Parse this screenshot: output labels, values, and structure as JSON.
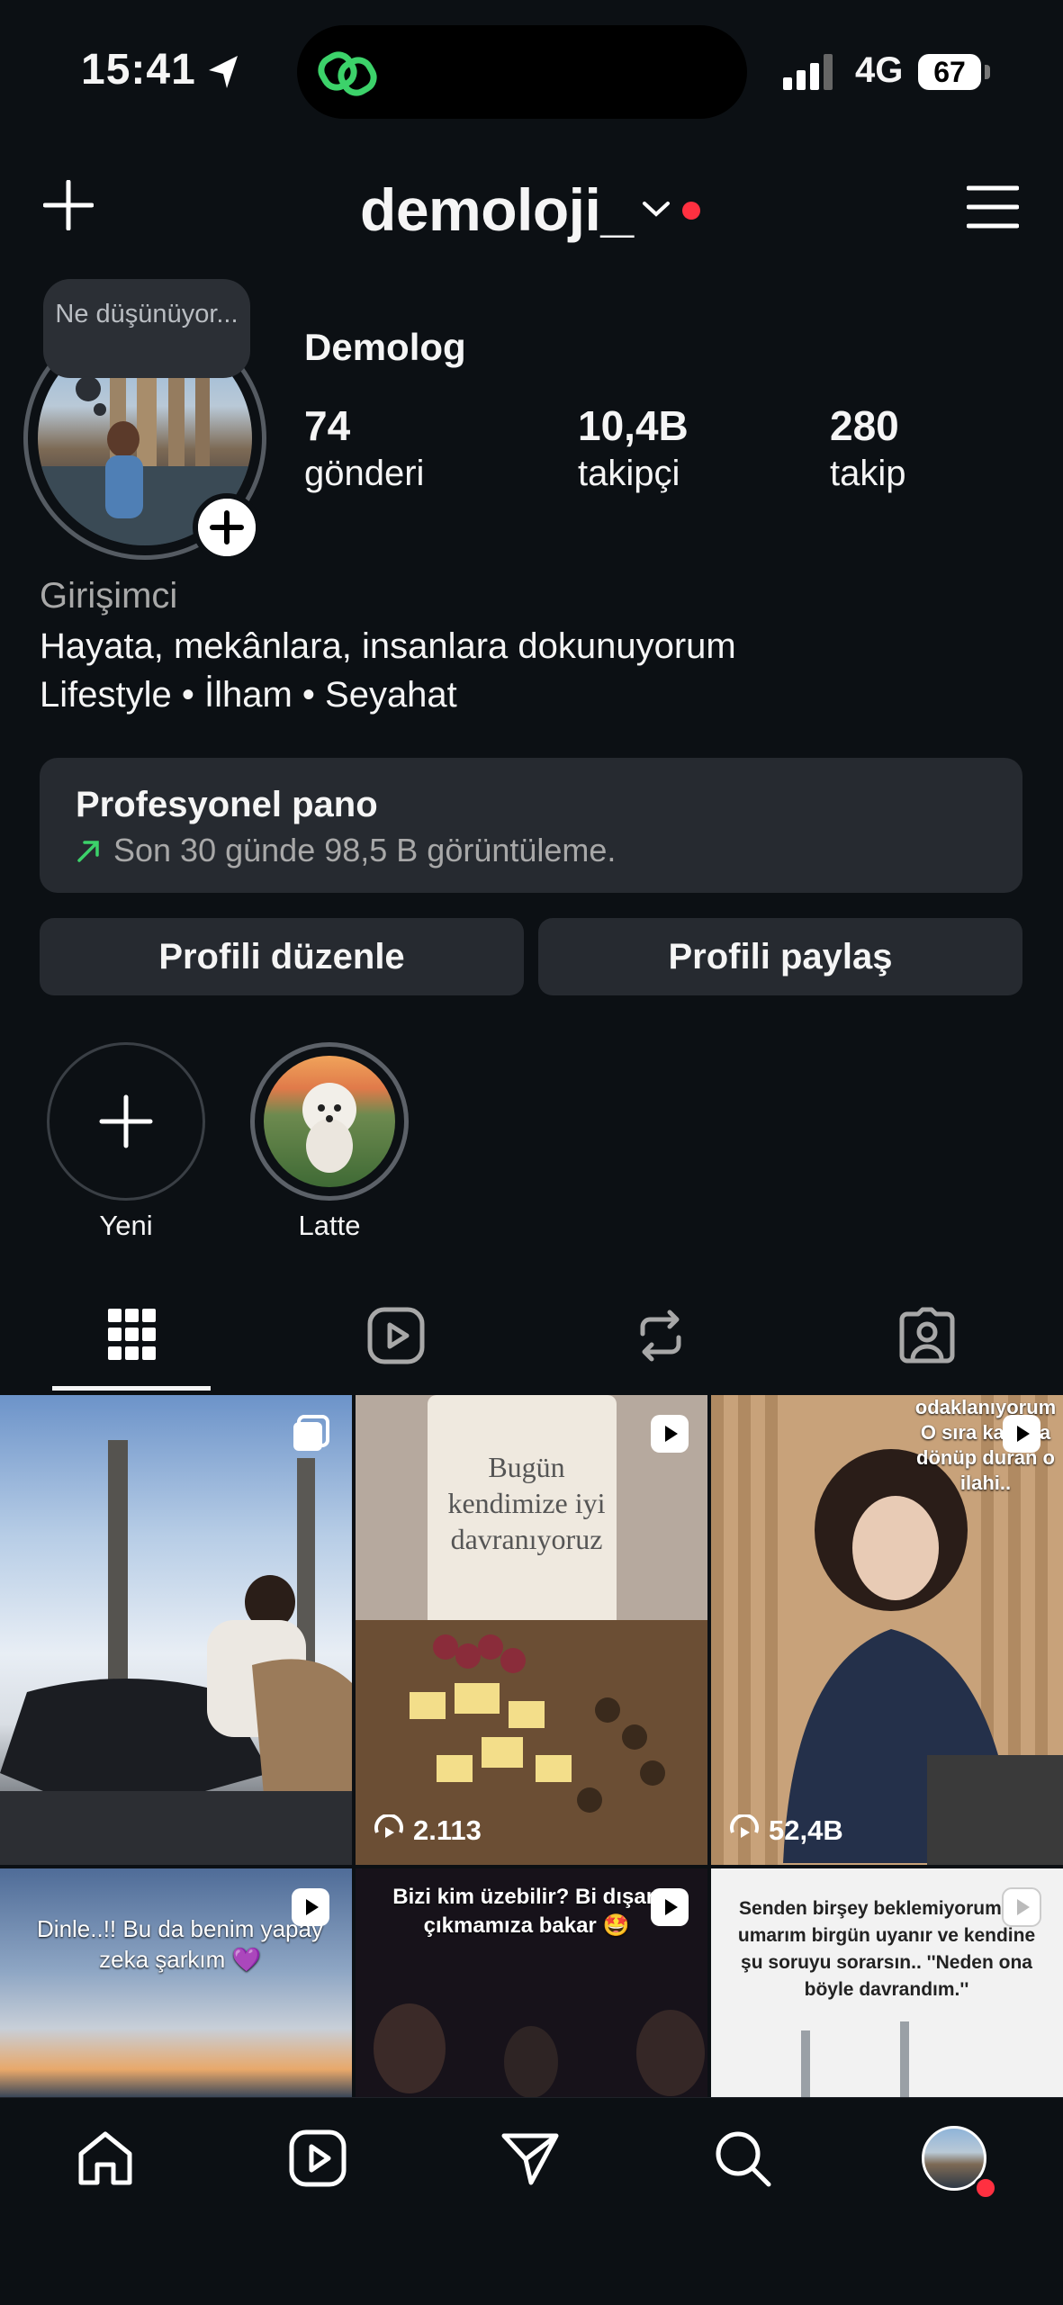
{
  "status_bar": {
    "time": "15:41",
    "network": "4G",
    "battery": "67"
  },
  "header": {
    "username": "demoloji_"
  },
  "profile": {
    "note_bubble": "Ne düşünüyor...",
    "display_name": "Demolog",
    "stats": [
      {
        "value": "74",
        "label": "gönderi"
      },
      {
        "value": "10,4B",
        "label": "takipçi"
      },
      {
        "value": "280",
        "label": "takip"
      }
    ],
    "bio": {
      "category": "Girişimci",
      "line1": "Hayata, mekânlara, insanlara dokunuyorum",
      "line2": "Lifestyle • İlham • Seyahat"
    }
  },
  "dashboard": {
    "title": "Profesyonel pano",
    "subtitle": "Son 30 günde 98,5 B görüntüleme."
  },
  "buttons": {
    "edit": "Profili düzenle",
    "share": "Profili paylaş"
  },
  "highlights": [
    {
      "label": "Yeni"
    },
    {
      "label": "Latte"
    }
  ],
  "tabs": [
    "grid-icon",
    "reels-icon",
    "reposts-icon",
    "tagged-icon"
  ],
  "posts": [
    {
      "type": "carousel",
      "views": ""
    },
    {
      "type": "reel",
      "views": "2.113",
      "caption": "Bugün kendimize iyi davranıyoruz"
    },
    {
      "type": "reel",
      "views": "52,4B",
      "caption": "odaklanıyorum O sıra kafama dönüp duran o ilahi.."
    },
    {
      "type": "reel",
      "caption": "Dinle..!! Bu da benim yapay zeka şarkım 💜"
    },
    {
      "type": "reel",
      "caption": "Bizi kim üzebilir? Bi dışarı çıkmamıza bakar 🤩"
    },
    {
      "type": "reel",
      "caption": "Senden birşey beklemiyorum am umarım birgün uyanır ve kendine şu soruyu sorarsın.. ''Neden ona böyle davrandım.''"
    }
  ],
  "colors": {
    "background": "#0c1014",
    "card": "#262a30",
    "notification": "#ff3040",
    "accent_green": "#3cd26a"
  }
}
